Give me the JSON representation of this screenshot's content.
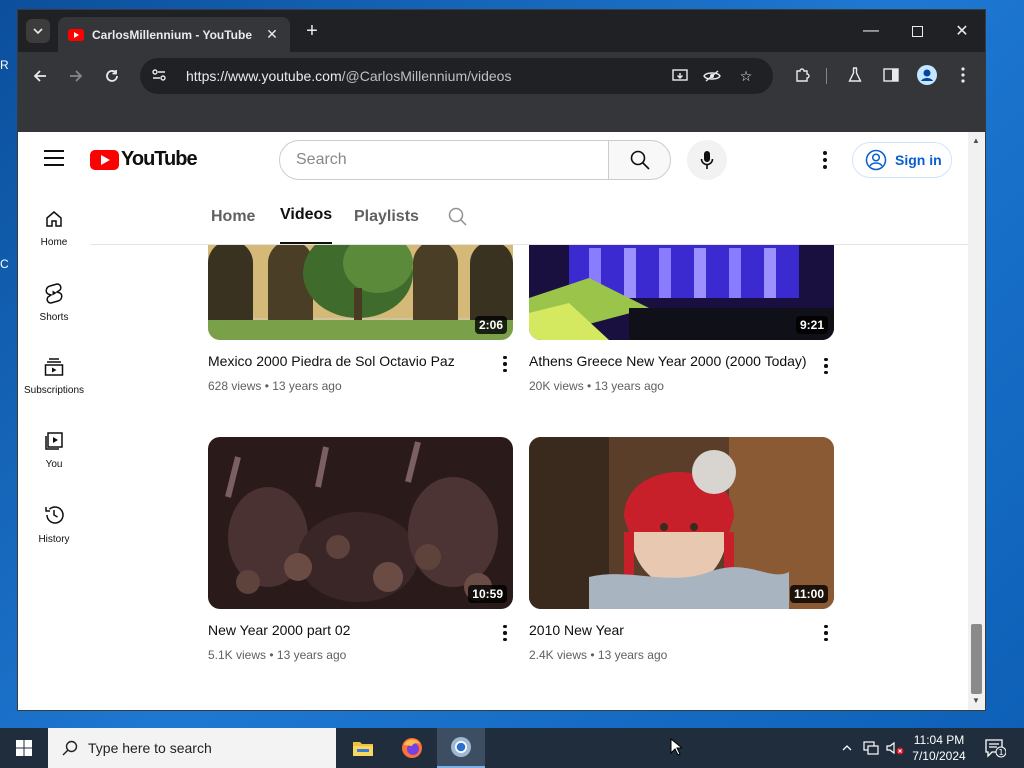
{
  "browser": {
    "tab_title": "CarlosMillennium - YouTube",
    "url_host": "https://www.youtube.com",
    "url_path": "/@CarlosMillennium/videos"
  },
  "youtube": {
    "logo_text": "YouTube",
    "search_placeholder": "Search",
    "signin_label": "Sign in",
    "guide": [
      {
        "label": "Home",
        "icon": "home-icon"
      },
      {
        "label": "Shorts",
        "icon": "shorts-icon"
      },
      {
        "label": "Subscriptions",
        "icon": "subscriptions-icon"
      },
      {
        "label": "You",
        "icon": "you-icon"
      },
      {
        "label": "History",
        "icon": "history-icon"
      }
    ],
    "channel_tabs": [
      {
        "label": "Home",
        "active": false
      },
      {
        "label": "Videos",
        "active": true
      },
      {
        "label": "Playlists",
        "active": false
      }
    ],
    "videos": [
      {
        "title": "Mexico 2000 Piedra de Sol Octavio Paz",
        "duration": "2:06",
        "views": "628 views",
        "age": "13 years ago"
      },
      {
        "title": "Athens Greece New Year 2000 (2000 Today)",
        "duration": "9:21",
        "views": "20K views",
        "age": "13 years ago"
      },
      {
        "title": "New Year 2000 part 02",
        "duration": "10:59",
        "views": "5.1K views",
        "age": "13 years ago"
      },
      {
        "title": "2010 New Year",
        "duration": "11:00",
        "views": "2.4K views",
        "age": "13 years ago"
      }
    ]
  },
  "taskbar": {
    "search_placeholder": "Type here to search",
    "time": "11:04 PM",
    "date": "7/10/2024",
    "notification_count": "1"
  },
  "desktop": {
    "edge_letters": [
      "R",
      "C"
    ]
  },
  "colors": {
    "yt_red": "#ff0000",
    "signin_blue": "#065fd4",
    "chrome_dark": "#202124",
    "chrome_toolbar": "#35363a"
  }
}
